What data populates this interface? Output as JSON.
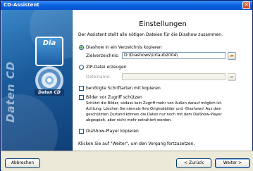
{
  "window": {
    "title": "CD-Assistent",
    "close_glyph": "✕"
  },
  "sidebar": {
    "vertical_text": "Daten CD",
    "logo_text": "Dia",
    "cd_label": "Daten CD"
  },
  "main": {
    "heading": "Einstellungen",
    "intro": "Der Assistent stellt alle nötigen Dateien für die Diashow zusammen.",
    "option_folder": {
      "label": "Diashow in ein Verzeichnis kopieren",
      "selected": true
    },
    "folder_field": {
      "label": "Zielverzeichnis:",
      "value": "D:\\Diashows\\Urlaub2004\\"
    },
    "option_zip": {
      "label": "ZIP-Datei erzeugen",
      "selected": false
    },
    "zip_field": {
      "label": "Dateiname:",
      "value": ""
    },
    "fonts_option": {
      "label": "benötigte Schriftarten mit kopieren",
      "checked": false
    },
    "protect_option": {
      "label": "Bilder vor Zugriff schützen",
      "checked": false,
      "desc_1": "Schützt die Bilder, sodass kein Zugriff mehr von Außen darauf möglich ist.",
      "desc_2": "Achtung: Löschen Sie niemals Ihre Originalbilder und -Diashows! Aus dem",
      "desc_3": "geschützten Zustand können die Daten nur noch mit dem DiaShow-Player",
      "desc_4": "abgespielt, aber nicht mehr extrahiert werden."
    },
    "player_option": {
      "label": "DiaShow-Player kopieren",
      "checked": false
    },
    "footer_hint": "Klicken Sie auf \"Weiter\", um den Vorgang fortzusetzen."
  },
  "buttons": {
    "cancel": "Abbrechen",
    "back": "< Zurück",
    "next": "Weiter >"
  },
  "icons": {
    "browse": "folder-open-icon"
  }
}
